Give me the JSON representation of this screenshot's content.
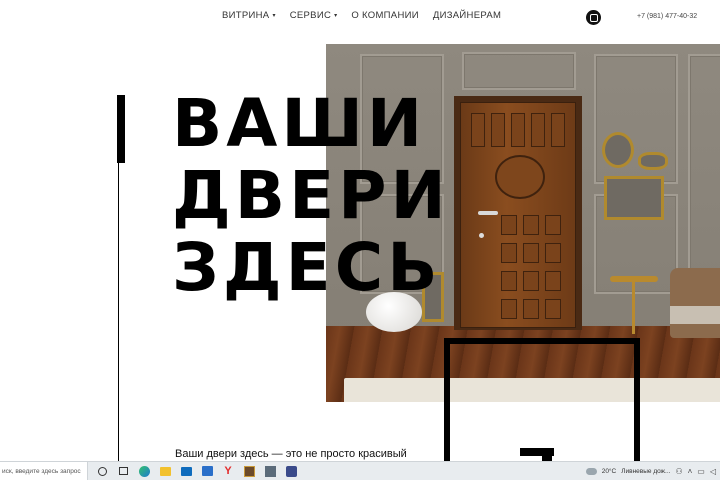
{
  "nav": {
    "items": [
      {
        "label": "ВИТРИНА",
        "has_caret": true
      },
      {
        "label": "СЕРВИС",
        "has_caret": true
      },
      {
        "label": "О КОМПАНИИ",
        "has_caret": false
      },
      {
        "label": "ДИЗАЙНЕРАМ",
        "has_caret": false
      }
    ],
    "caret": "▾",
    "phone": "+7 (981) 477-40-32"
  },
  "hero": {
    "headline_lines": [
      "ВАШИ",
      "ДВЕРИ",
      "ЗДЕСЬ"
    ],
    "lead": "Ваши двери здесь — это не просто красивый"
  },
  "taskbar": {
    "search_text": "иск, введите здесь запрос",
    "temperature": "20°C",
    "weather": "Ливневые дож..."
  },
  "colors": {
    "text": "#000000",
    "nav_text": "#333333",
    "taskbar_bg": "#e8ecef",
    "door_wood": "#8a4d1f",
    "wall": "#8a8378"
  }
}
